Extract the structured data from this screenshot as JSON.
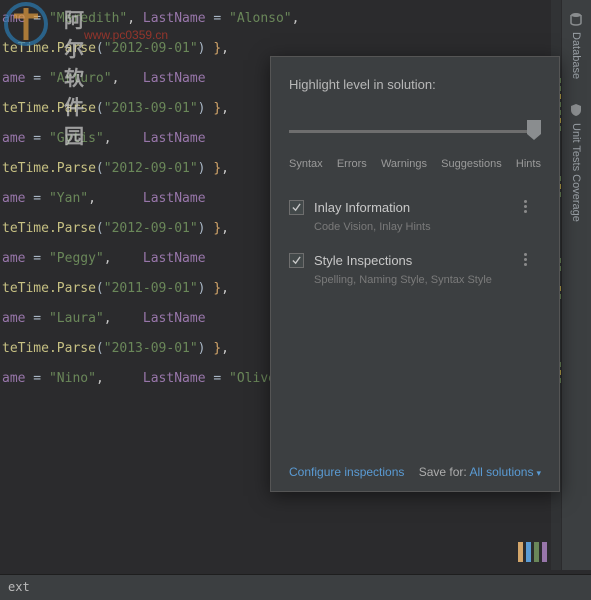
{
  "watermark": {
    "text": "阿尔软件园",
    "url": "www.pc0359.cn"
  },
  "code": {
    "lines": [
      {
        "pre": "ame = ",
        "str": "\"Meredith\"",
        "mid": ", LastName = ",
        "str2": "\"Alonso\"",
        "post": ","
      },
      {
        "method": "teTime.Parse",
        "arg": "\"2012-09-01\"",
        "tail": ") },"
      },
      {
        "pre": "ame = ",
        "str": "\"Arturo\"",
        "mid": ",   LastName",
        "post": ""
      },
      {
        "method": "teTime.Parse",
        "arg": "\"2013-09-01\"",
        "tail": ") },"
      },
      {
        "pre": "ame = ",
        "str": "\"Gytis\"",
        "mid": ",    LastName",
        "post": ""
      },
      {
        "method": "teTime.Parse",
        "arg": "\"2012-09-01\"",
        "tail": ") },"
      },
      {
        "pre": "ame = ",
        "str": "\"Yan\"",
        "mid": ",      LastName",
        "post": ""
      },
      {
        "method": "teTime.Parse",
        "arg": "\"2012-09-01\"",
        "tail": ") },"
      },
      {
        "pre": "ame = ",
        "str": "\"Peggy\"",
        "mid": ",    LastName",
        "post": ""
      },
      {
        "method": "teTime.Parse",
        "arg": "\"2011-09-01\"",
        "tail": ") },"
      },
      {
        "pre": "ame = ",
        "str": "\"Laura\"",
        "mid": ",    LastName",
        "post": ""
      },
      {
        "method": "teTime.Parse",
        "arg": "\"2013-09-01\"",
        "tail": ") },"
      },
      {
        "pre": "ame = ",
        "str": "\"Nino\"",
        "mid": ",     LastName = ",
        "str2": "\"Olivetto\"",
        "post": ","
      }
    ]
  },
  "popup": {
    "title": "Highlight level in solution:",
    "slider": {
      "labels": [
        "Syntax",
        "Errors",
        "Warnings",
        "Suggestions",
        "Hints"
      ],
      "value": "Hints"
    },
    "checks": [
      {
        "label": "Inlay Information",
        "sub": "Code Vision, Inlay Hints",
        "checked": true
      },
      {
        "label": "Style Inspections",
        "sub": "Spelling, Naming Style, Syntax Style",
        "checked": true
      }
    ],
    "configure": "Configure inspections",
    "save_for_label": "Save for:",
    "save_for_value": "All solutions"
  },
  "right_tools": [
    {
      "name": "Database",
      "icon": "database"
    },
    {
      "name": "Unit Tests Coverage",
      "icon": "coverage"
    }
  ],
  "bottom": {
    "text": "ext"
  },
  "pencils": [
    "#d4a66a",
    "#5a9bd4",
    "#6a8759",
    "#9876aa"
  ]
}
